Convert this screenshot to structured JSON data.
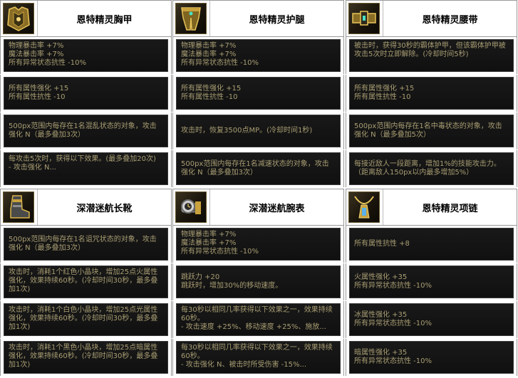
{
  "items": [
    {
      "name": "恩特精灵胸甲",
      "icon": "golden-chest-armor-icon",
      "rows": [
        "物理暴击率 +7%\n魔法暴击率 +7%\n所有异常状态抗性 -10%",
        "所有属性强化 +15\n所有属性抗性 -10",
        "500px范围内每存在1名混乱状态的对象，攻击强化 N（最多叠加3次）",
        "每攻击5次时，获得以下效果。(最多叠加20次)\n- 攻击强化 N..."
      ]
    },
    {
      "name": "恩特精灵护腿",
      "icon": "golden-leg-armor-icon",
      "rows": [
        "物理暴击率 +7%\n魔法暴击率 +7%\n所有异常状态抗性 -10%",
        "所有属性强化 +15\n所有属性抗性 -10",
        "攻击时，恢复3500点MP。(冷却时间1秒)",
        "500px范围内每存在1名减速状态的对象，攻击强化 N（最多叠加3次）"
      ]
    },
    {
      "name": "恩特精灵腰带",
      "icon": "golden-belt-icon",
      "rows": [
        "被击时，获得30秒的霸体护甲，但该霸体护甲被攻击5次时立即解除。(冷却时间5秒)",
        "所有属性强化 +15\n所有属性抗性 -10",
        "500px范围内每存在1名中毒状态的对象，攻击强化 N（最多叠加5次）",
        "每接近敌人一段距离，增加1%的技能攻击力。（距离敌人150px以内最多增加5%）"
      ]
    },
    {
      "name": "深潜迷航长靴",
      "icon": "diving-boots-icon",
      "rows": [
        "500px范围内每存在1名诅咒状态的对象，攻击强化 N（最多叠加3次）",
        "攻击时，消耗1个红色小晶块，增加25点火属性强化，效果持续60秒。(冷却时间30秒，最多叠加1次)",
        "攻击时，消耗1个白色小晶块，增加25点光属性强化，效果持续60秒。(冷却时间30秒，最多叠加1次)",
        "攻击时，消耗1个黑色小晶块，增加25点暗属性强化，效果持续60秒。(冷却时间30秒，最多叠加1次)"
      ]
    },
    {
      "name": "深潜迷航腕表",
      "icon": "diving-wristwatch-icon",
      "rows": [
        "物理暴击率 +7%\n魔法暴击率 +7%\n所有异常状态抗性 -10%",
        "跳跃力 +20\n跳跃时，增加30%的移动速度。",
        "每30秒以相同几率获得以下效果之一，效果持续60秒。\n- 攻击速度 +25%、移动速度 +25%、施放...",
        "每30秒以相同几率获得以下效果之一，效果持续60秒。\n- 攻击强化 N、被击时所受伤害 -15%..."
      ]
    },
    {
      "name": "恩特精灵项链",
      "icon": "golden-necklace-icon",
      "rows": [
        "所有属性抗性 +8",
        "火属性强化 +35\n所有异常状态抗性 -10%",
        "冰属性强化 +35\n所有异常状态抗性 -10%",
        "暗属性强化 +35\n所有异常状态抗性 -10%"
      ]
    }
  ]
}
